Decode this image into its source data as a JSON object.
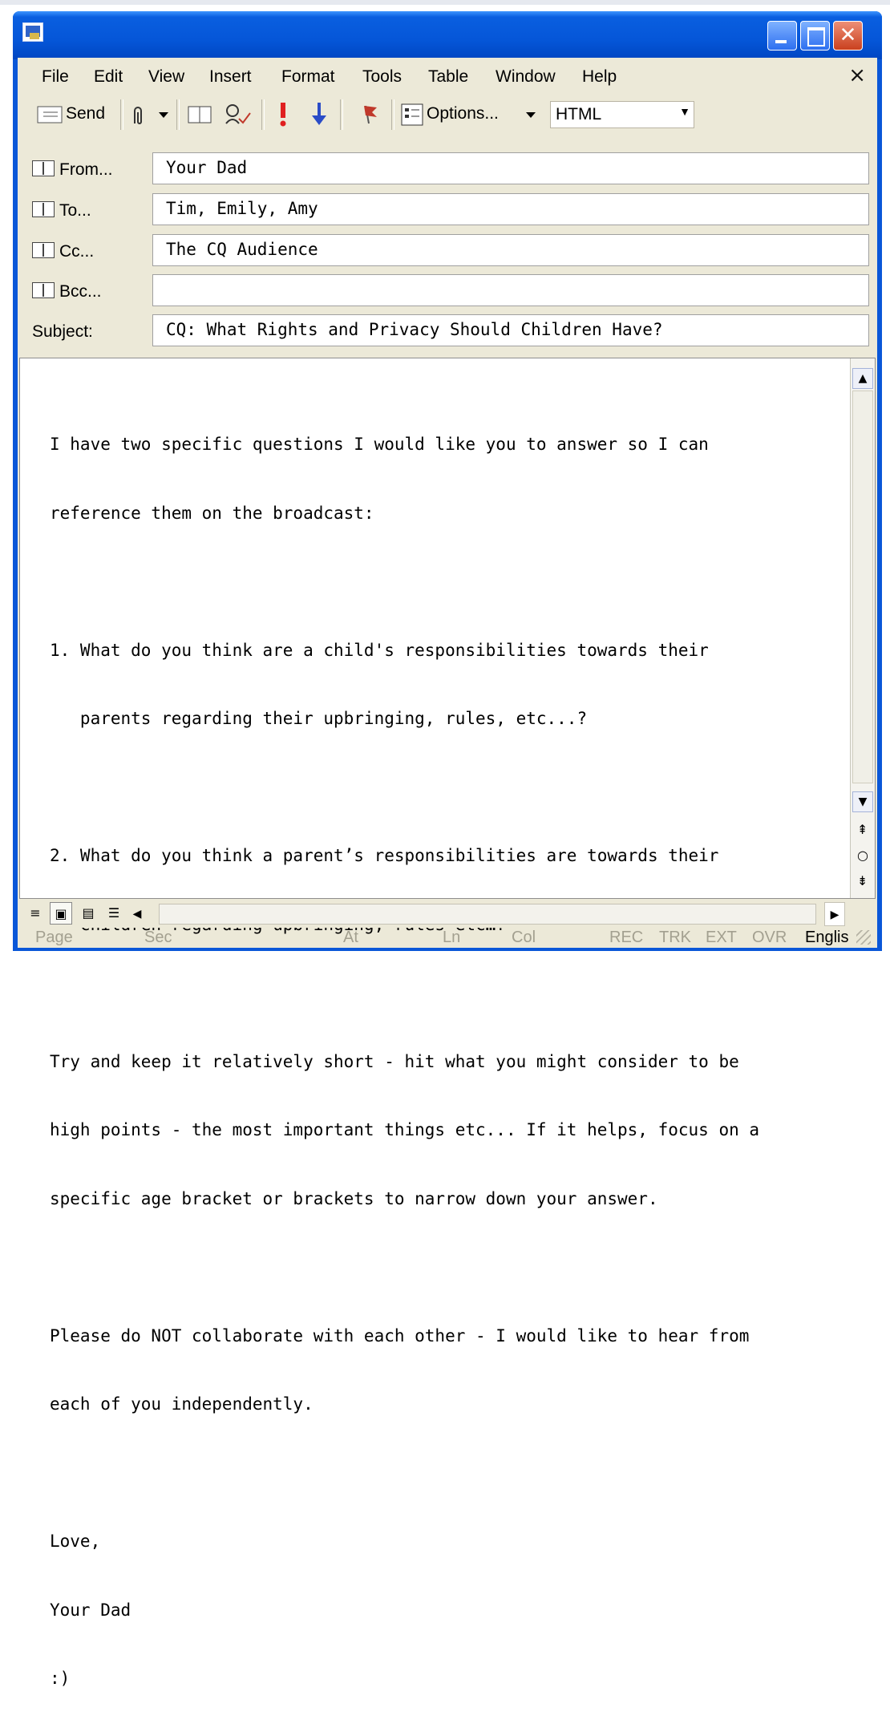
{
  "window": {
    "title": "",
    "close_glyph": "✕"
  },
  "menus": [
    "File",
    "Edit",
    "View",
    "Insert",
    "Format",
    "Tools",
    "Table",
    "Window",
    "Help"
  ],
  "menu_close_glyph": "×",
  "toolbar": {
    "send_label": "Send",
    "options_label": "Options...",
    "format_value": "HTML",
    "icons": [
      "send-icon",
      "paperclip-icon",
      "address-book-icon",
      "check-names-icon",
      "high-importance-icon",
      "low-importance-icon",
      "flag-icon",
      "options-icon"
    ]
  },
  "header": {
    "from_label": "From...",
    "from_value": "Your Dad",
    "to_label": "To...",
    "to_value": "Tim, Emily, Amy",
    "cc_label": "Cc...",
    "cc_value": "The CQ Audience",
    "bcc_label": "Bcc...",
    "bcc_value": "",
    "subject_label": "Subject:",
    "subject_value": "CQ: What Rights and Privacy Should Children Have?"
  },
  "body": {
    "lines": [
      "I have two specific questions I would like you to answer so I can",
      "reference them on the broadcast:",
      "",
      "1. What do you think are a child's responsibilities towards their",
      "   parents regarding their upbringing, rules, etc...?",
      "",
      "2. What do you think a parent’s responsibilities are towards their",
      "   children regarding upbringing, rules etc…?",
      "",
      "Try and keep it relatively short - hit what you might consider to be",
      "high points - the most important things etc... If it helps, focus on a",
      "specific age bracket or brackets to narrow down your answer.",
      "",
      "Please do NOT collaborate with each other - I would like to hear from",
      "each of you independently.",
      "",
      "Love,",
      "Your Dad",
      ":)"
    ]
  },
  "statusbar": {
    "page": "Page",
    "sec": "Sec",
    "at": "At",
    "ln": "Ln",
    "col": "Col",
    "rec": "REC",
    "trk": "TRK",
    "ext": "EXT",
    "ovr": "OVR",
    "language": "Englis"
  }
}
